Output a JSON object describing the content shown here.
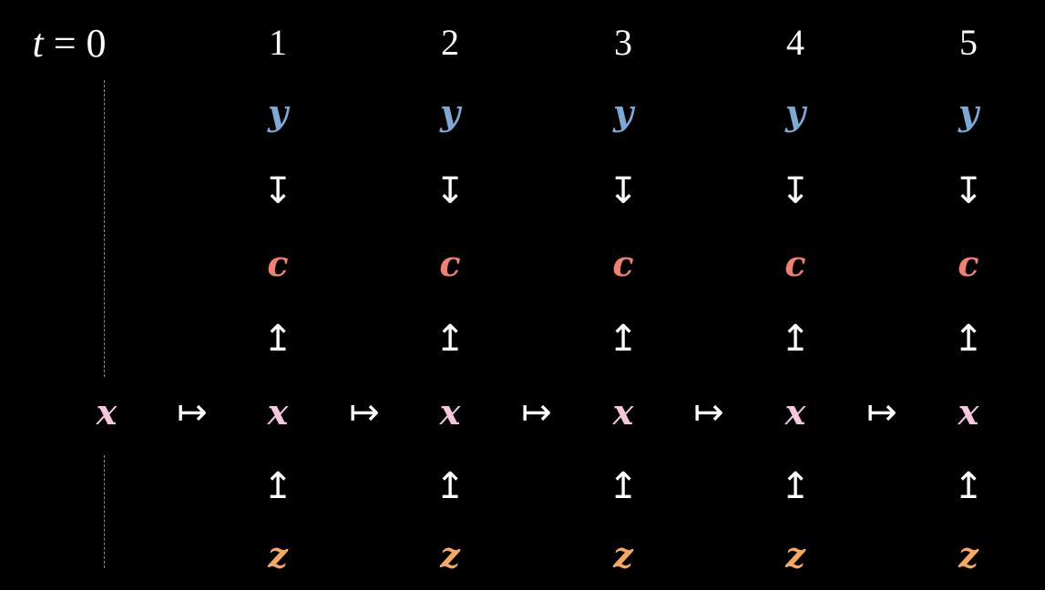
{
  "time_label": {
    "t": "t",
    "eq": "= 0"
  },
  "steps": [
    "1",
    "2",
    "3",
    "4",
    "5"
  ],
  "symbols": {
    "y": "y",
    "c": "c",
    "x": "x",
    "z": "z",
    "down_arrow": "↧",
    "up_arrow": "↥",
    "maps_to": "↦"
  },
  "colors": {
    "background": "#000000",
    "y": "#7ea9d6",
    "c": "#f08070",
    "x": "#f5c6dc",
    "z": "#f5a860",
    "arrow": "#ffffff",
    "dashed_line": "#8a8a8a"
  }
}
